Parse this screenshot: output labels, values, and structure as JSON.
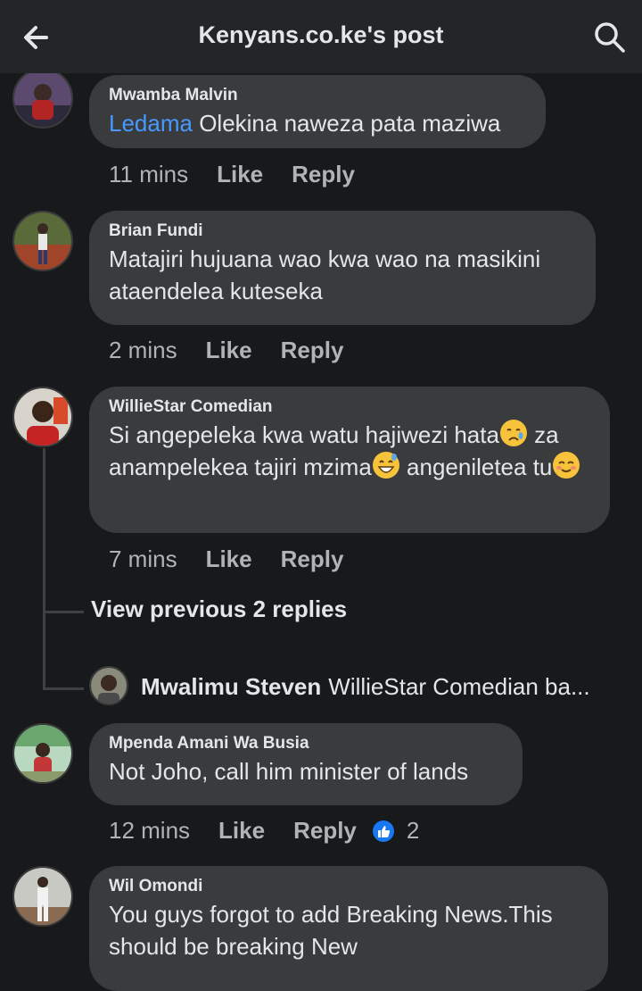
{
  "header": {
    "title": "Kenyans.co.ke's post",
    "back_icon": "back-arrow-icon",
    "search_icon": "search-icon"
  },
  "comments": [
    {
      "author": "Mwamba Malvin",
      "mention": "Ledama",
      "text": " Olekina naweza pata maziwa",
      "time": "11 mins",
      "like": "Like",
      "reply": "Reply"
    },
    {
      "author": "Brian Fundi",
      "text": "Matajiri hujuana wao kwa wao na masikini ataendelea kuteseka",
      "time": "2 mins",
      "like": "Like",
      "reply": "Reply"
    },
    {
      "author": "WillieStar Comedian",
      "text_1": "Si angepeleka kwa watu hajiwezi hata",
      "text_2": " za anampelekea tajiri mzima",
      "text_3": " angeniletea tu",
      "time": "7 mins",
      "like": "Like",
      "reply": "Reply"
    },
    {
      "author": "Mpenda Amani Wa Busia",
      "text": "Not Joho, call him minister of lands",
      "time": "12 mins",
      "like": "Like",
      "reply": "Reply",
      "reactions": "2"
    },
    {
      "author": "Wil Omondi",
      "text": "You guys forgot to add Breaking News.This should be breaking New"
    }
  ],
  "thread": {
    "view_previous": "View previous 2 replies",
    "reply_author": "Mwalimu Steven",
    "reply_preview": "WillieStar Comedian ba..."
  },
  "colors": {
    "background": "#18191a",
    "bubble": "#3a3b3c",
    "mention": "#4599ff",
    "meta": "#b0b3b8",
    "like_badge": "#1877f2"
  }
}
